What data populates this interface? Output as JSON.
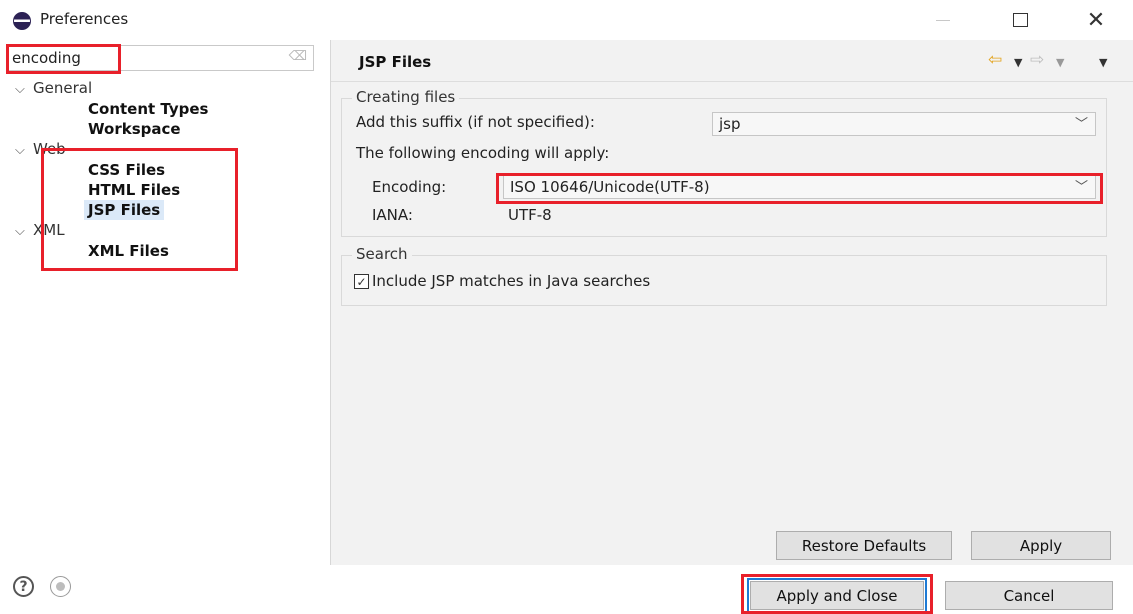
{
  "window": {
    "title": "Preferences",
    "close_glyph": "✕",
    "icon": "eclipse-icon"
  },
  "filter": {
    "value": "encoding",
    "clear_icon": "eraser-icon",
    "clear_glyph": "⌫"
  },
  "tree": {
    "expand_glyph": "⌵",
    "groups": [
      {
        "label": "General",
        "children": [
          "Content Types",
          "Workspace"
        ]
      },
      {
        "label": "Web",
        "children": [
          "CSS Files",
          "HTML Files",
          "JSP Files"
        ]
      },
      {
        "label": "XML",
        "children": [
          "XML Files"
        ]
      }
    ],
    "selected": "JSP Files"
  },
  "page": {
    "title": "JSP Files",
    "nav": {
      "back_glyph": "⇦",
      "forward_glyph": "⇨",
      "menu_glyph": "▼"
    },
    "creating_files": {
      "group_label": "Creating files",
      "suffix_label": "Add this suffix (if not specified):",
      "suffix_value": "jsp",
      "encoding_intro": "The following encoding will apply:",
      "encoding_label": "Encoding:",
      "encoding_value": "ISO 10646/Unicode(UTF-8)",
      "iana_label": "IANA:",
      "iana_value": "UTF-8",
      "combo_arrow": "﹀"
    },
    "search": {
      "group_label": "Search",
      "checkbox_label": "Include JSP matches in Java searches",
      "checkbox_checked": true,
      "check_glyph": "✓"
    },
    "buttons": {
      "restore_defaults": "Restore Defaults",
      "apply": "Apply"
    }
  },
  "footer": {
    "help_glyph": "?",
    "apply_and_close": "Apply and Close",
    "cancel": "Cancel"
  },
  "colors": {
    "highlight": "#e8202a",
    "selection": "#dbe9f8",
    "nav_back": "#e3a21a"
  }
}
